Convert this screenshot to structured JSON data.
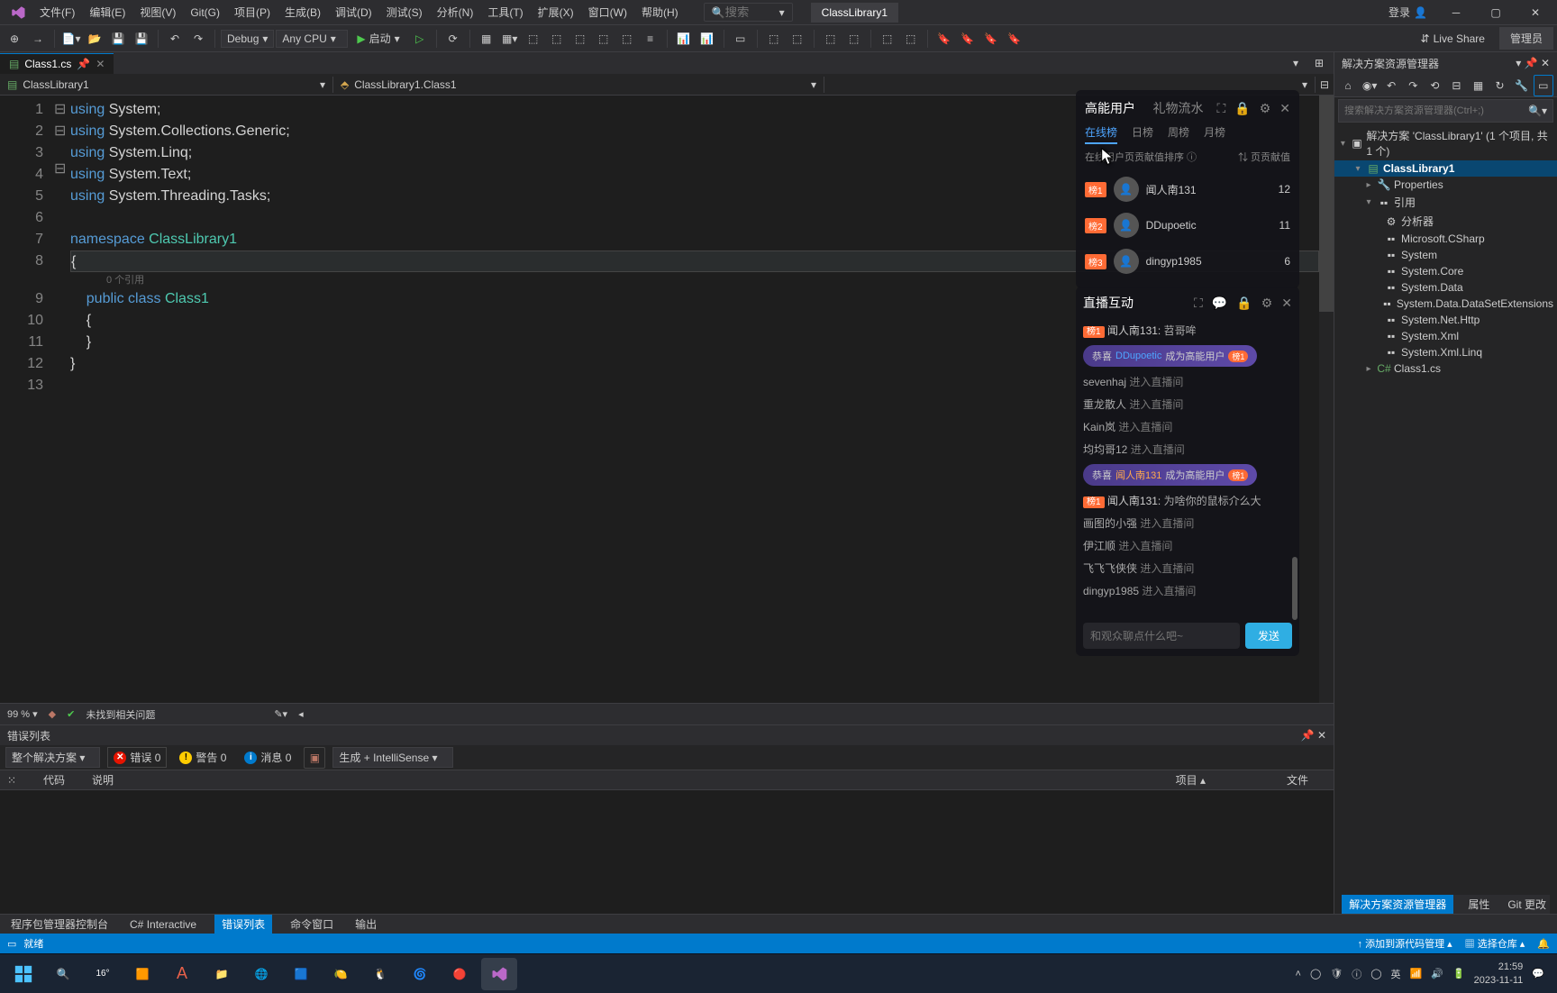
{
  "menu": {
    "file": "文件(F)",
    "edit": "编辑(E)",
    "view": "视图(V)",
    "git": "Git(G)",
    "project": "项目(P)",
    "build": "生成(B)",
    "debug": "调试(D)",
    "test": "测试(S)",
    "analyze": "分析(N)",
    "tools": "工具(T)",
    "extensions": "扩展(X)",
    "window": "窗口(W)",
    "help": "帮助(H)"
  },
  "search": {
    "placeholder": "搜索",
    "dropdown": "▾"
  },
  "project_tab": "ClassLibrary1",
  "login": "登录",
  "toolbar": {
    "config": "Debug",
    "platform": "Any CPU",
    "start": "启动",
    "live_share": "Live Share",
    "admin": "管理员"
  },
  "file_tabs": {
    "tab1": "Class1.cs"
  },
  "nav": {
    "left": "ClassLibrary1",
    "right": "ClassLibrary1.Class1"
  },
  "gutter": [
    "1",
    "2",
    "3",
    "4",
    "5",
    "6",
    "7",
    "8",
    "",
    "9",
    "10",
    "11",
    "12",
    "13"
  ],
  "code": {
    "l1": {
      "k": "using",
      "n": " System",
      "p": ";"
    },
    "l2": {
      "k": "using",
      "n": " System.Collections.Generic",
      "p": ";"
    },
    "l3": {
      "k": "using",
      "n": " System.Linq",
      "p": ";"
    },
    "l4": {
      "k": "using",
      "n": " System.Text",
      "p": ";"
    },
    "l5": {
      "k": "using",
      "n": " System.Threading.Tasks",
      "p": ";"
    },
    "l7a": {
      "k": "namespace",
      "c": " ClassLibrary1"
    },
    "l8": "{",
    "hint": "0 个引用",
    "l9": {
      "i": "    ",
      "k1": "public ",
      "k2": "class ",
      "c": "Class1"
    },
    "l10": "    {",
    "l11": "    }",
    "l12": "}"
  },
  "editor_status": {
    "zoom": "99 %",
    "issues": "未找到相关问题"
  },
  "error_panel": {
    "title": "错误列表",
    "scope": "整个解决方案",
    "errors": "错误 0",
    "warnings": "警告 0",
    "messages": "消息 0",
    "build": "生成 + IntelliSense",
    "cols": {
      "code": "代码",
      "desc": "说明",
      "proj": "项目",
      "file": "文件"
    }
  },
  "solution": {
    "title": "解决方案资源管理器",
    "search_ph": "搜索解决方案资源管理器(Ctrl+;)",
    "root": "解决方案 'ClassLibrary1' (1 个项目, 共 1 个)",
    "proj": "ClassLibrary1",
    "props": "Properties",
    "refs": "引用",
    "analyzers": "分析器",
    "r1": "Microsoft.CSharp",
    "r2": "System",
    "r3": "System.Core",
    "r4": "System.Data",
    "r5": "System.Data.DataSetExtensions",
    "r6": "System.Net.Http",
    "r7": "System.Xml",
    "r8": "System.Xml.Linq",
    "class1": "Class1.cs"
  },
  "bottom_tabs": {
    "pkg": "程序包管理器控制台",
    "csi": "C# Interactive",
    "err": "错误列表",
    "cmd": "命令窗口",
    "out": "输出",
    "sol": "解决方案资源管理器",
    "props": "属性",
    "git": "Git 更改"
  },
  "status": {
    "ready": "就绪",
    "add_src": "添加到源代码管理",
    "select_repo": "选择仓库"
  },
  "stream_users": {
    "title": "高能用户",
    "gifts": "礼物流水",
    "t1": "在线榜",
    "t2": "日榜",
    "t3": "周榜",
    "t4": "月榜",
    "sub": "在线用户页贡献值排序",
    "col2": "页贡献值",
    "rows": [
      {
        "badge": "榜1",
        "name": "闻人南131",
        "score": "12"
      },
      {
        "badge": "榜2",
        "name": "DDupoetic",
        "score": "11"
      },
      {
        "badge": "榜3",
        "name": "dingyp1985",
        "score": "6"
      }
    ]
  },
  "stream_chat": {
    "title": "直播互动",
    "m0_badge": "榜1",
    "m0_name": "闻人南131:",
    "m0_txt": "苕哥哞",
    "b1_pre": "恭喜",
    "b1_name": "DDupoetic",
    "b1_suf": "成为高能用户",
    "b1_tag": "榜1",
    "m1": "sevenhaj",
    "m1s": "进入直播间",
    "m2": "重龙散人",
    "m2s": "进入直播间",
    "m3": "Kain岚",
    "m3s": "进入直播间",
    "m4": "均均哥12",
    "m4s": "进入直播间",
    "b2_pre": "恭喜",
    "b2_name": "闻人南131",
    "b2_suf": "成为高能用户",
    "b2_tag": "榜1",
    "m5_badge": "榜1",
    "m5_name": "闻人南131:",
    "m5_txt": "为啥你的鼠标介么大",
    "m6": "画图的小强",
    "m6s": "进入直播间",
    "m7": "伊江顺",
    "m7s": "进入直播间",
    "m8": "飞飞飞侠侠",
    "m8s": "进入直播间",
    "m9": "dingyp1985",
    "m9s": "进入直播间",
    "input_ph": "和观众聊点什么吧~",
    "send": "发送"
  },
  "taskbar": {
    "weather": "16°"
  },
  "tray": {
    "time": "21:59",
    "date": "2023-11-11"
  }
}
